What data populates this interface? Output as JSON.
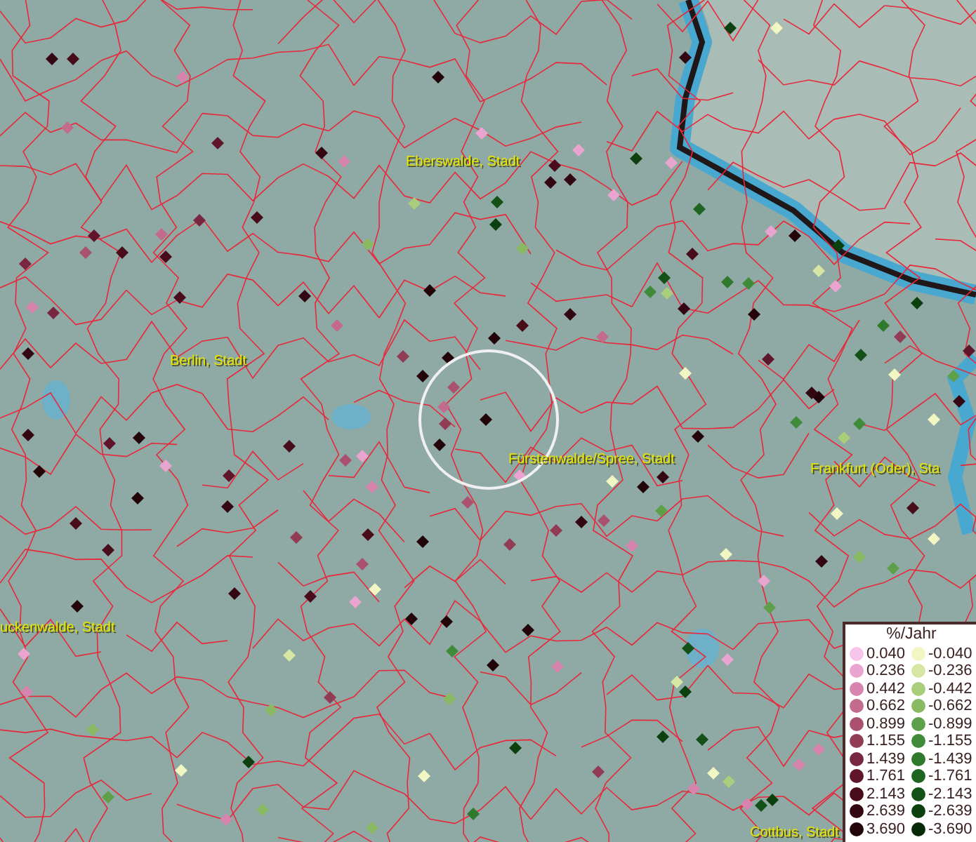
{
  "map": {
    "places": [
      {
        "name": "Eberswalde, Stadt"
      },
      {
        "name": "Berlin, Stadt"
      },
      {
        "name": "Fürstenwalde/Spree, Stadt"
      },
      {
        "name": "Frankfurt (Oder), Sta"
      },
      {
        "name": "uckenwalde, Stadt"
      },
      {
        "name": "Cottbus, Stadt"
      }
    ]
  },
  "legend": {
    "title": "%/Jahr",
    "positive": [
      {
        "label": "0.040",
        "color": "#f7c4ea"
      },
      {
        "label": "0.236",
        "color": "#e9a4cf"
      },
      {
        "label": "0.442",
        "color": "#d785ae"
      },
      {
        "label": "0.662",
        "color": "#c26b8c"
      },
      {
        "label": "0.899",
        "color": "#aa5170"
      },
      {
        "label": "1.155",
        "color": "#913b55"
      },
      {
        "label": "1.439",
        "color": "#792740"
      },
      {
        "label": "1.761",
        "color": "#60162a"
      },
      {
        "label": "2.143",
        "color": "#480c1b"
      },
      {
        "label": "2.639",
        "color": "#340812"
      },
      {
        "label": "3.690",
        "color": "#220409"
      }
    ],
    "negative": [
      {
        "label": "-0.040",
        "color": "#f2f6c2"
      },
      {
        "label": "-0.236",
        "color": "#d5e7a3"
      },
      {
        "label": "-0.442",
        "color": "#a9cd7a"
      },
      {
        "label": "-0.662",
        "color": "#89b962"
      },
      {
        "label": "-0.899",
        "color": "#5e9f4a"
      },
      {
        "label": "-1.155",
        "color": "#408b3a"
      },
      {
        "label": "-1.439",
        "color": "#2f7a2d"
      },
      {
        "label": "-1.761",
        "color": "#1f6521"
      },
      {
        "label": "-2.143",
        "color": "#135118"
      },
      {
        "label": "-2.639",
        "color": "#0c400f"
      },
      {
        "label": "-3.690",
        "color": "#062a08"
      }
    ]
  }
}
